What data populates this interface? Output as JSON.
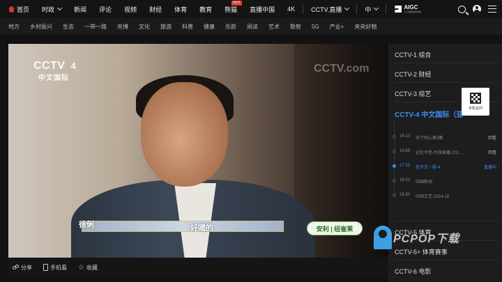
{
  "topnav": {
    "home": "首页",
    "items": [
      "时政",
      "新闻",
      "评论",
      "视频",
      "财经",
      "体育",
      "教育",
      "熊猫",
      "直播中国",
      "4K",
      "CCTV.直播",
      "中"
    ],
    "hot_badge": "HOT",
    "aigc_label": "AIGC",
    "aigc_sub": "人工智能生成内容"
  },
  "subnav": [
    "地方",
    "乡村振兴",
    "生态",
    "一带一路",
    "央博",
    "文化",
    "旅游",
    "科普",
    "健康",
    "乐龄",
    "阅读",
    "艺术",
    "数智",
    "5G",
    "产业+",
    "央央好物"
  ],
  "player": {
    "logo_main": "CCTV",
    "logo_num": "4",
    "logo_sub": "中文国际",
    "logo_ghost": "CCTV.com",
    "caption_name": "徐俐",
    "caption_quote": "好喝的",
    "sponsor": "安利 | 纽崔莱"
  },
  "controls": {
    "share": "分享",
    "phone": "手机看",
    "favorite": "收藏"
  },
  "sidebar": {
    "channels_top": [
      "CCTV-1 综合",
      "CCTV-2 财经",
      "CCTV-3 综艺"
    ],
    "active_channel": "CCTV-4 中文国际（亚",
    "schedule": [
      {
        "time": "16:10",
        "name": "天下同心第3集",
        "action": "回看"
      },
      {
        "time": "16:58",
        "name": "记住乡愁-片段展播-202...",
        "action": "回看"
      },
      {
        "time": "17:03",
        "name": "花开又一程-4",
        "action": "直播中"
      },
      {
        "time": "18:00",
        "name": "中国新闻",
        "action": ""
      },
      {
        "time": "18:30",
        "name": "中国文艺-2024-18",
        "action": ""
      }
    ],
    "channels_bottom": [
      "CCTV-5 体育",
      "CCTV-5+ 体育赛事",
      "CCTV-6 电影"
    ],
    "qr_label": "手机访问"
  },
  "watermark": "PCPOP下载"
}
